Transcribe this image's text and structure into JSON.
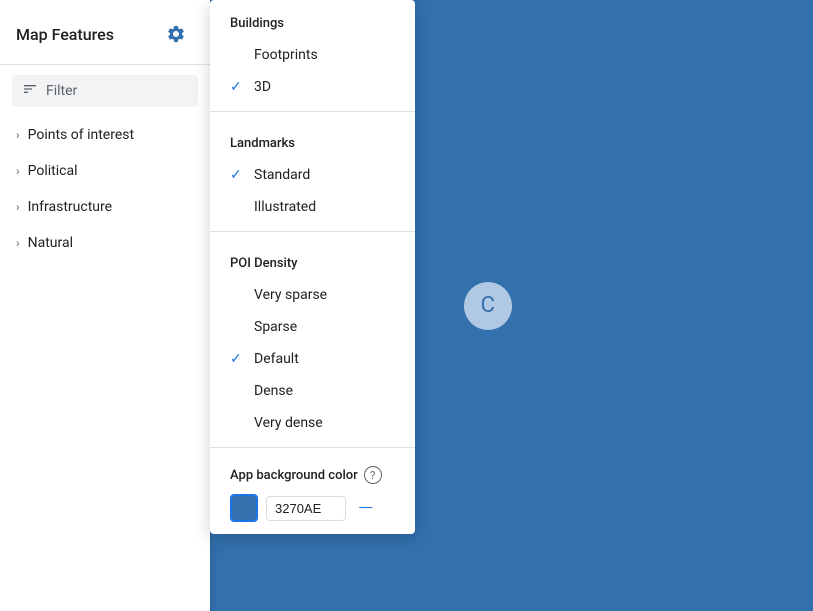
{
  "sidebar": {
    "title": "Map Features",
    "filter_placeholder": "Filter",
    "nav_items": [
      {
        "label": "Points of interest"
      },
      {
        "label": "Political"
      },
      {
        "label": "Infrastructure"
      },
      {
        "label": "Natural"
      }
    ]
  },
  "dropdown": {
    "sections": [
      {
        "label": "Buildings",
        "items": [
          {
            "label": "Footprints",
            "checked": false
          },
          {
            "label": "3D",
            "checked": true
          }
        ]
      },
      {
        "label": "Landmarks",
        "items": [
          {
            "label": "Standard",
            "checked": true
          },
          {
            "label": "Illustrated",
            "checked": false
          }
        ]
      },
      {
        "label": "POI Density",
        "items": [
          {
            "label": "Very sparse",
            "checked": false
          },
          {
            "label": "Sparse",
            "checked": false
          },
          {
            "label": "Default",
            "checked": true
          },
          {
            "label": "Dense",
            "checked": false
          },
          {
            "label": "Very dense",
            "checked": false
          }
        ]
      }
    ],
    "app_bg_color": {
      "label": "App background color",
      "value": "3270AE",
      "color": "#3270AE"
    }
  },
  "spinner": {
    "label": "C"
  },
  "icons": {
    "gear": "⚙",
    "filter_lines": "≡",
    "arrow_right": "›",
    "checkmark": "✓",
    "question": "?",
    "minus": "—"
  }
}
